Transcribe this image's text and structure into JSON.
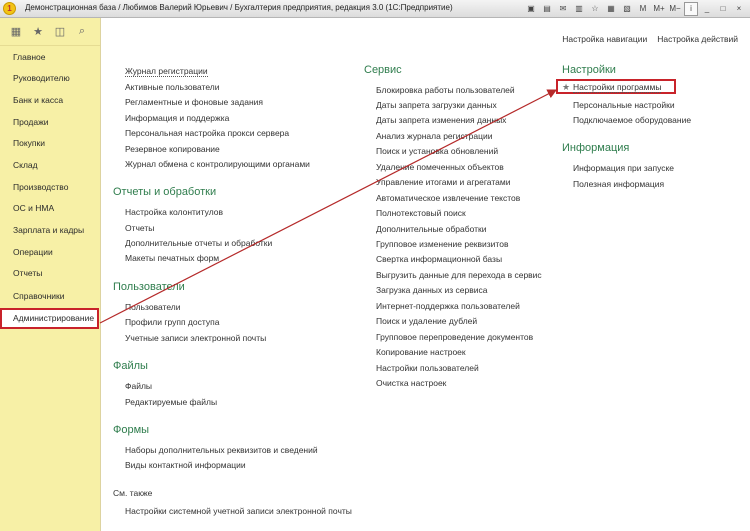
{
  "window": {
    "title": "Демонстрационная база / Любимов Валерий Юрьевич / Бухгалтерия предприятия, редакция 3.0  (1С:Предприятие)",
    "controls": [
      "M",
      "M+",
      "M−",
      "i",
      "_",
      "□",
      "×"
    ]
  },
  "sidebar": {
    "items": [
      {
        "label": "Главное"
      },
      {
        "label": "Руководителю"
      },
      {
        "label": "Банк и касса"
      },
      {
        "label": "Продажи"
      },
      {
        "label": "Покупки"
      },
      {
        "label": "Склад"
      },
      {
        "label": "Производство"
      },
      {
        "label": "ОС и НМА"
      },
      {
        "label": "Зарплата и кадры"
      },
      {
        "label": "Операции"
      },
      {
        "label": "Отчеты"
      },
      {
        "label": "Справочники"
      },
      {
        "label": "Администрирование"
      }
    ]
  },
  "top_actions": {
    "nav_settings": "Настройка навигации",
    "actions_settings": "Настройка действий"
  },
  "column1": {
    "links": [
      "Журнал регистрации",
      "Активные пользователи",
      "Регламентные и фоновые задания",
      "Информация и поддержка",
      "Персональная настройка прокси сервера",
      "Резервное копирование",
      "Журнал обмена с контролирующими органами"
    ],
    "reports": {
      "title": "Отчеты и обработки",
      "links": [
        "Настройка колонтитулов",
        "Отчеты",
        "Дополнительные отчеты и обработки",
        "Макеты печатных форм"
      ]
    },
    "users": {
      "title": "Пользователи",
      "links": [
        "Пользователи",
        "Профили групп доступа",
        "Учетные записи электронной почты"
      ]
    },
    "files": {
      "title": "Файлы",
      "links": [
        "Файлы",
        "Редактируемые файлы"
      ]
    },
    "forms": {
      "title": "Формы",
      "links": [
        "Наборы дополнительных реквизитов и сведений",
        "Виды контактной информации"
      ]
    },
    "see_also": {
      "title": "См. также",
      "links": [
        "Настройки системной учетной записи электронной почты"
      ]
    }
  },
  "service": {
    "title": "Сервис",
    "links": [
      "Блокировка работы пользователей",
      "Даты запрета загрузки данных",
      "Даты запрета изменения данных",
      "Анализ журнала регистрации",
      "Поиск и установка обновлений",
      "Удаление помеченных объектов",
      "Управление итогами и агрегатами",
      "Автоматическое извлечение текстов",
      "Полнотекстовый поиск",
      "Дополнительные обработки",
      "Групповое изменение реквизитов",
      "Свертка информационной базы",
      "Выгрузить данные для перехода в сервис",
      "Загрузка данных из сервиса",
      "Интернет-поддержка пользователей",
      "Поиск и удаление дублей",
      "Групповое перепроведение документов",
      "Копирование настроек",
      "Настройки пользователей",
      "Очистка настроек"
    ]
  },
  "settings": {
    "title": "Настройки",
    "links": [
      "Настройки программы",
      "Персональные настройки",
      "Подключаемое оборудование"
    ]
  },
  "info": {
    "title": "Информация",
    "links": [
      "Информация при запуске",
      "Полезная информация"
    ]
  },
  "colors": {
    "accent_green": "#2f7d4d",
    "sidebar_bg": "#f7f0a6",
    "highlight_red": "#c8232a"
  }
}
